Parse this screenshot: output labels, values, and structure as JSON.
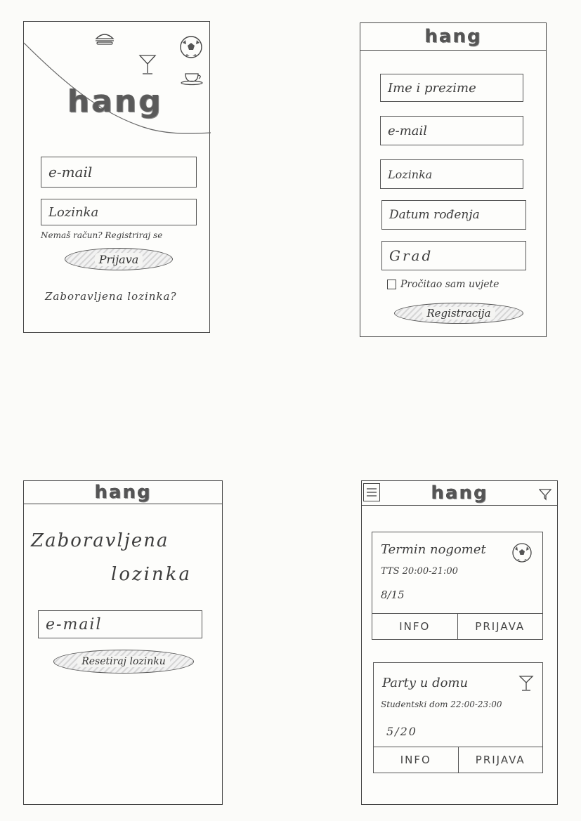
{
  "screen_login": {
    "logo": "hang",
    "email_placeholder": "e-mail",
    "password_placeholder": "Lozinka",
    "register_prompt": "Nemaš račun? Registriraj se",
    "login_button": "Prijava",
    "forgot_link": "Zaboravljena lozinka?"
  },
  "screen_register": {
    "logo": "hang",
    "name_placeholder": "Ime i prezime",
    "email_placeholder": "e-mail",
    "password_placeholder": "Lozinka",
    "birthdate_placeholder": "Datum rođenja",
    "city_placeholder": "Grad",
    "terms_label": "Pročitao sam uvjete",
    "register_button": "Registracija"
  },
  "screen_forgot": {
    "logo": "hang",
    "title_line1": "Zaboravljena",
    "title_line2": "lozinka",
    "email_placeholder": "e-mail",
    "reset_button": "Resetiraj lozinku"
  },
  "screen_feed": {
    "logo": "hang",
    "events": [
      {
        "title": "Termin nogomet",
        "details": "TTS 20:00-21:00",
        "count": "8/15",
        "icon": "soccer-ball-icon",
        "info_label": "INFO",
        "signup_label": "PRIJAVA"
      },
      {
        "title": "Party u domu",
        "details": "Studentski dom 22:00-23:00",
        "count": "5/20",
        "icon": "cocktail-icon",
        "info_label": "INFO",
        "signup_label": "PRIJAVA"
      }
    ]
  }
}
